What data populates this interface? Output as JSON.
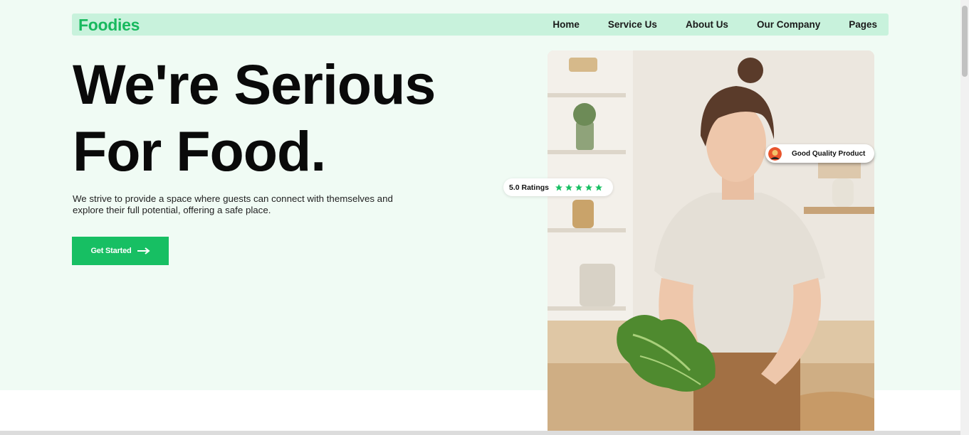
{
  "brand": {
    "logo_text": "Foodies",
    "accent": "#17bf63",
    "hero_bg": "#f0fbf4",
    "nav_bg": "#c8f2dc"
  },
  "nav": {
    "items": [
      {
        "label": "Home"
      },
      {
        "label": "Service Us"
      },
      {
        "label": "About Us"
      },
      {
        "label": "Our Company"
      },
      {
        "label": "Pages"
      }
    ]
  },
  "hero": {
    "headline_line1": "We're Serious",
    "headline_line2": "For Food.",
    "subtext": "We strive to provide a space where guests can connect with themselves and explore their full potential, offering a safe place.",
    "cta_label": "Get Started",
    "cta_icon": "arrow-right-icon"
  },
  "badges": {
    "rating_text": "5.0 Ratings",
    "rating_stars": 5,
    "quality_text": "Good Quality Product"
  }
}
